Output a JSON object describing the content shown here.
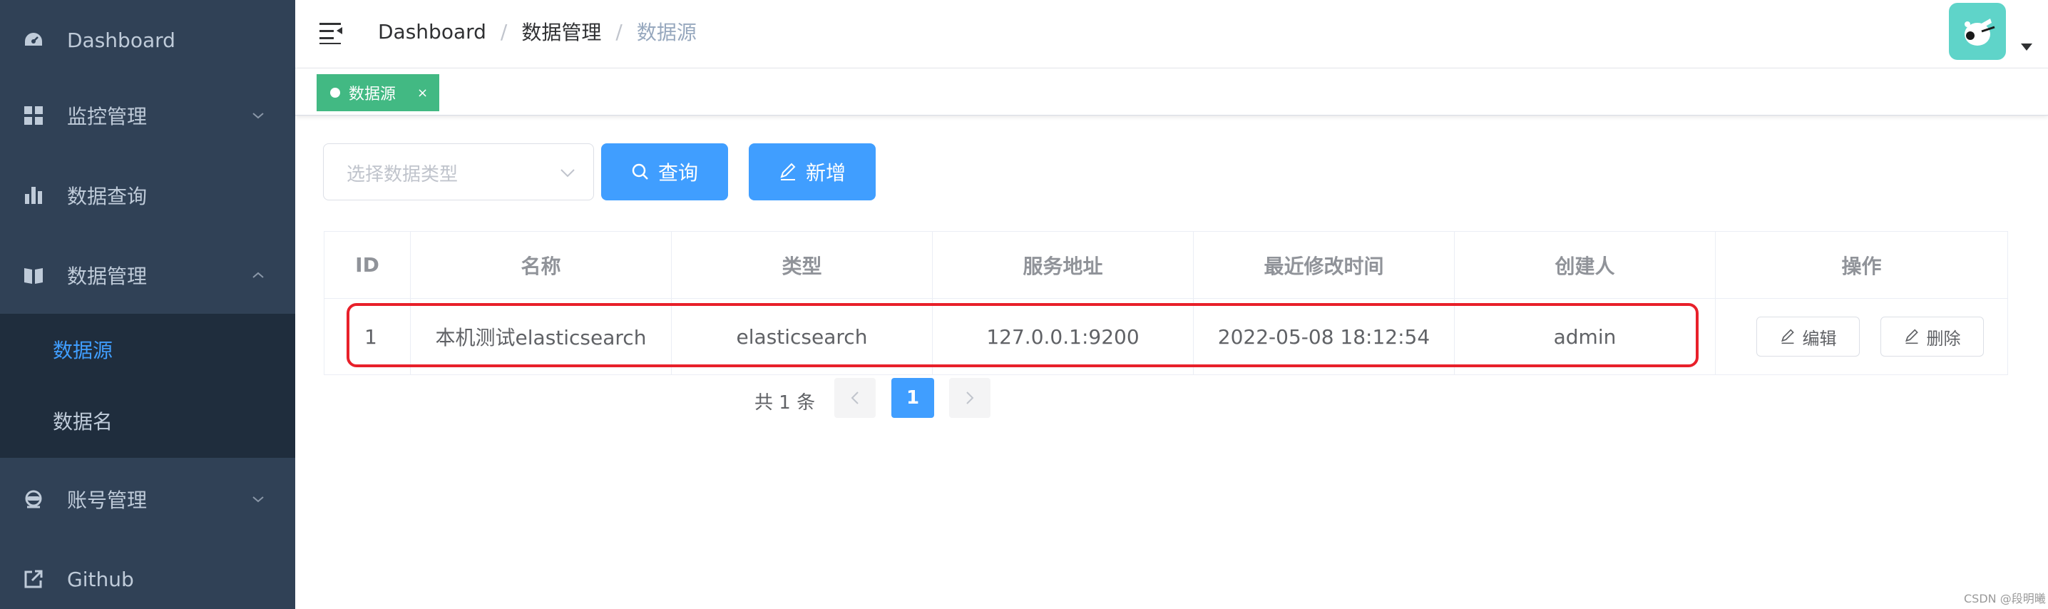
{
  "sidebar": {
    "items": [
      {
        "label": "Dashboard",
        "icon": "dashboard-icon"
      },
      {
        "label": "监控管理",
        "icon": "grid-icon"
      },
      {
        "label": "数据查询",
        "icon": "bar-chart-icon"
      },
      {
        "label": "数据管理",
        "icon": "book-icon"
      },
      {
        "label": "账号管理",
        "icon": "user-icon"
      },
      {
        "label": "Github",
        "icon": "external-link-icon"
      }
    ],
    "submenu": [
      {
        "label": "数据源",
        "active": true
      },
      {
        "label": "数据名",
        "active": false
      }
    ]
  },
  "navbar": {
    "breadcrumb": [
      "Dashboard",
      "数据管理",
      "数据源"
    ]
  },
  "tags": [
    {
      "label": "数据源",
      "close": "×"
    }
  ],
  "filter": {
    "select_placeholder": "选择数据类型",
    "query_label": "查询",
    "add_label": "新增"
  },
  "table": {
    "headers": [
      "ID",
      "名称",
      "类型",
      "服务地址",
      "最近修改时间",
      "创建人",
      "操作"
    ],
    "rows": [
      {
        "id": "1",
        "name": "本机测试elasticsearch",
        "type": "elasticsearch",
        "address": "127.0.0.1:9200",
        "modified": "2022-05-08 18:12:54",
        "creator": "admin",
        "edit_label": "编辑",
        "delete_label": "删除"
      }
    ]
  },
  "pagination": {
    "total_text": "共 1 条",
    "current_page": "1"
  },
  "watermark": "CSDN @段明曦",
  "colors": {
    "sidebar_bg": "#304156",
    "submenu_bg": "#1f2d3d",
    "primary": "#409eff",
    "tag_green": "#42b983",
    "highlight_red": "#e8202a"
  }
}
